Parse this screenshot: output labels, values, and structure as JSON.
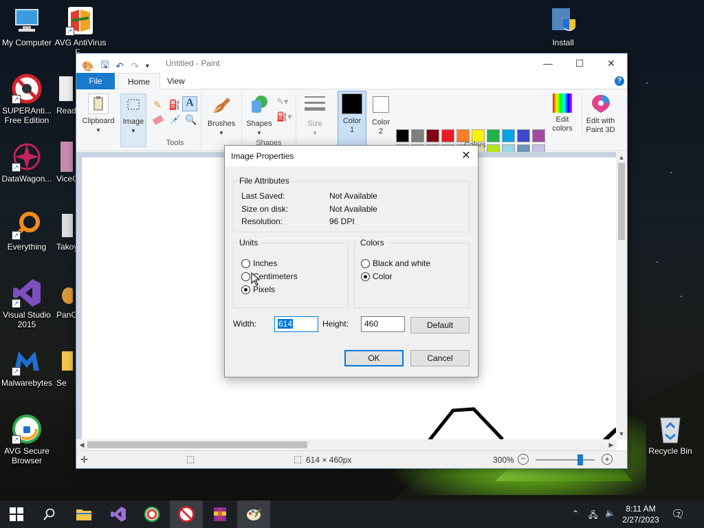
{
  "desktop": {
    "icons_left": [
      {
        "label": "My Computer"
      },
      {
        "label": "AVG AntiVirus F..."
      },
      {
        "label": "SUPERAnti... Free Edition"
      },
      {
        "label": "Readl"
      },
      {
        "label": "DataWagon..."
      },
      {
        "label": "ViceC"
      },
      {
        "label": "Everything"
      },
      {
        "label": "Takoy"
      },
      {
        "label": "Visual Studio 2015"
      },
      {
        "label": "PanC"
      },
      {
        "label": "Malwarebytes"
      },
      {
        "label": "Se"
      },
      {
        "label": "AVG Secure Browser"
      }
    ],
    "install": "Install",
    "recycle_bin": "Recycle Bin"
  },
  "paint": {
    "title": "Untitled - Paint",
    "tabs": {
      "file": "File",
      "home": "Home",
      "view": "View"
    },
    "help": "?",
    "ribbon": {
      "clipboard": "Clipboard",
      "image": "Image",
      "tools": "Tools",
      "brushes": "Brushes",
      "shapes": "Shapes",
      "shapes_group": "Shapes",
      "size": "Size",
      "color1": "Color",
      "color1_num": "1",
      "color2": "Color",
      "color2_num": "2",
      "colors_group": "Colors",
      "edit_colors": "Edit colors",
      "edit_3d": "Edit with Paint 3D"
    },
    "palette_row1": [
      "#000000",
      "#7f7f7f",
      "#880015",
      "#ed1c24",
      "#ff7f27",
      "#fff200",
      "#22b14c",
      "#00a2e8",
      "#3f48cc",
      "#a349a4"
    ],
    "palette_row2": [
      "#ffffff",
      "#c3c3c3",
      "#b97a57",
      "#ffaec9",
      "#ffc90e",
      "#efe4b0",
      "#b5e61d",
      "#99d9ea",
      "#7092be",
      "#c8bfe7"
    ],
    "status": {
      "dimensions": "614 × 460px",
      "zoom": "300%",
      "zoom_level": 0.75
    }
  },
  "dialog": {
    "title": "Image Properties",
    "file_attributes": {
      "legend": "File Attributes",
      "last_saved_label": "Last Saved:",
      "last_saved_value": "Not Available",
      "size_label": "Size on disk:",
      "size_value": "Not Available",
      "resolution_label": "Resolution:",
      "resolution_value": "96 DPI"
    },
    "units": {
      "legend": "Units",
      "inches": "Inches",
      "centimeters": "Centimeters",
      "pixels": "Pixels",
      "selected": "pixels"
    },
    "colors": {
      "legend": "Colors",
      "bw": "Black and white",
      "color": "Color",
      "selected": "color"
    },
    "width_label": "Width:",
    "width_value": "614",
    "height_label": "Height:",
    "height_value": "460",
    "default_btn": "Default",
    "ok_btn": "OK",
    "cancel_btn": "Cancel"
  },
  "taskbar": {
    "time": "8:11 AM",
    "date": "2/27/2023",
    "notifications": "7"
  }
}
